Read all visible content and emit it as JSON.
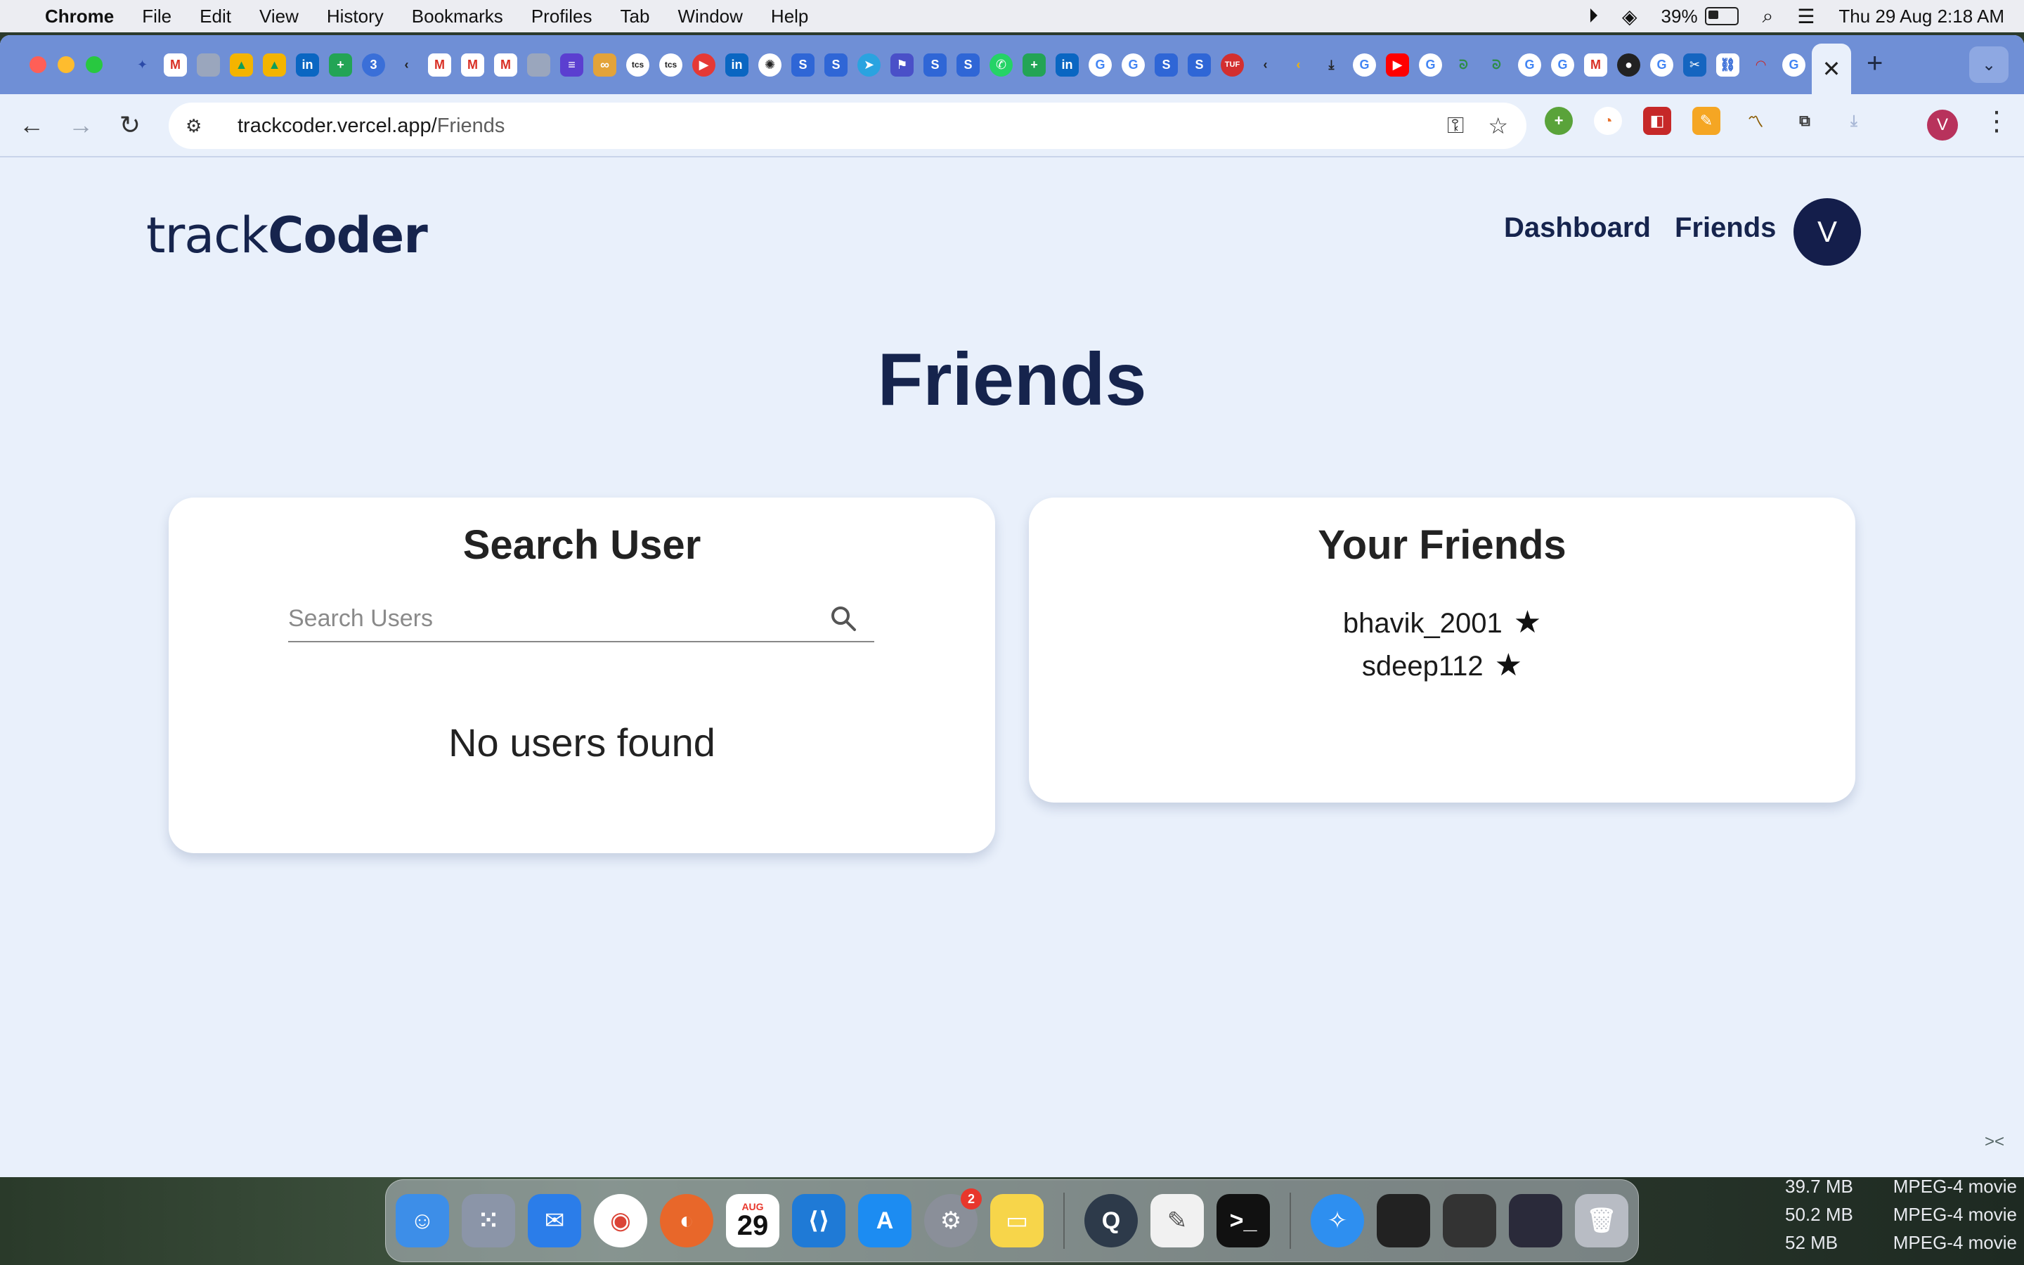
{
  "menubar": {
    "app_name": "Chrome",
    "menus": [
      "File",
      "Edit",
      "View",
      "History",
      "Bookmarks",
      "Profiles",
      "Tab",
      "Window",
      "Help"
    ],
    "battery_percent": "39%",
    "clock": "Thu 29 Aug  2:18 AM"
  },
  "browser": {
    "url_host": "trackcoder.vercel.app/",
    "url_path": "Friends",
    "active_tab_close": "✕",
    "new_tab": "+",
    "profile_initial": "V"
  },
  "site": {
    "logo_light": "track",
    "logo_bold": "Coder",
    "nav": {
      "dashboard": "Dashboard",
      "friends": "Friends"
    },
    "avatar_initial": "V"
  },
  "page": {
    "title": "Friends",
    "search_card": {
      "title": "Search User",
      "placeholder": "Search Users",
      "empty_message": "No users found"
    },
    "friends_card": {
      "title": "Your Friends",
      "friends": [
        "bhavik_2001",
        "sdeep112"
      ]
    }
  },
  "dock": {
    "calendar_month": "AUG",
    "calendar_day": "29",
    "settings_badge": "2"
  },
  "finder_rows": [
    {
      "size": "39.7 MB",
      "kind": "MPEG-4 movie"
    },
    {
      "size": "50.2 MB",
      "kind": "MPEG-4 movie"
    },
    {
      "size": "52 MB",
      "kind": "MPEG-4 movie"
    }
  ],
  "colors": {
    "brand_navy": "#16244d",
    "page_bg": "#e9f0fb",
    "tabstrip": "#6f8fd6"
  }
}
